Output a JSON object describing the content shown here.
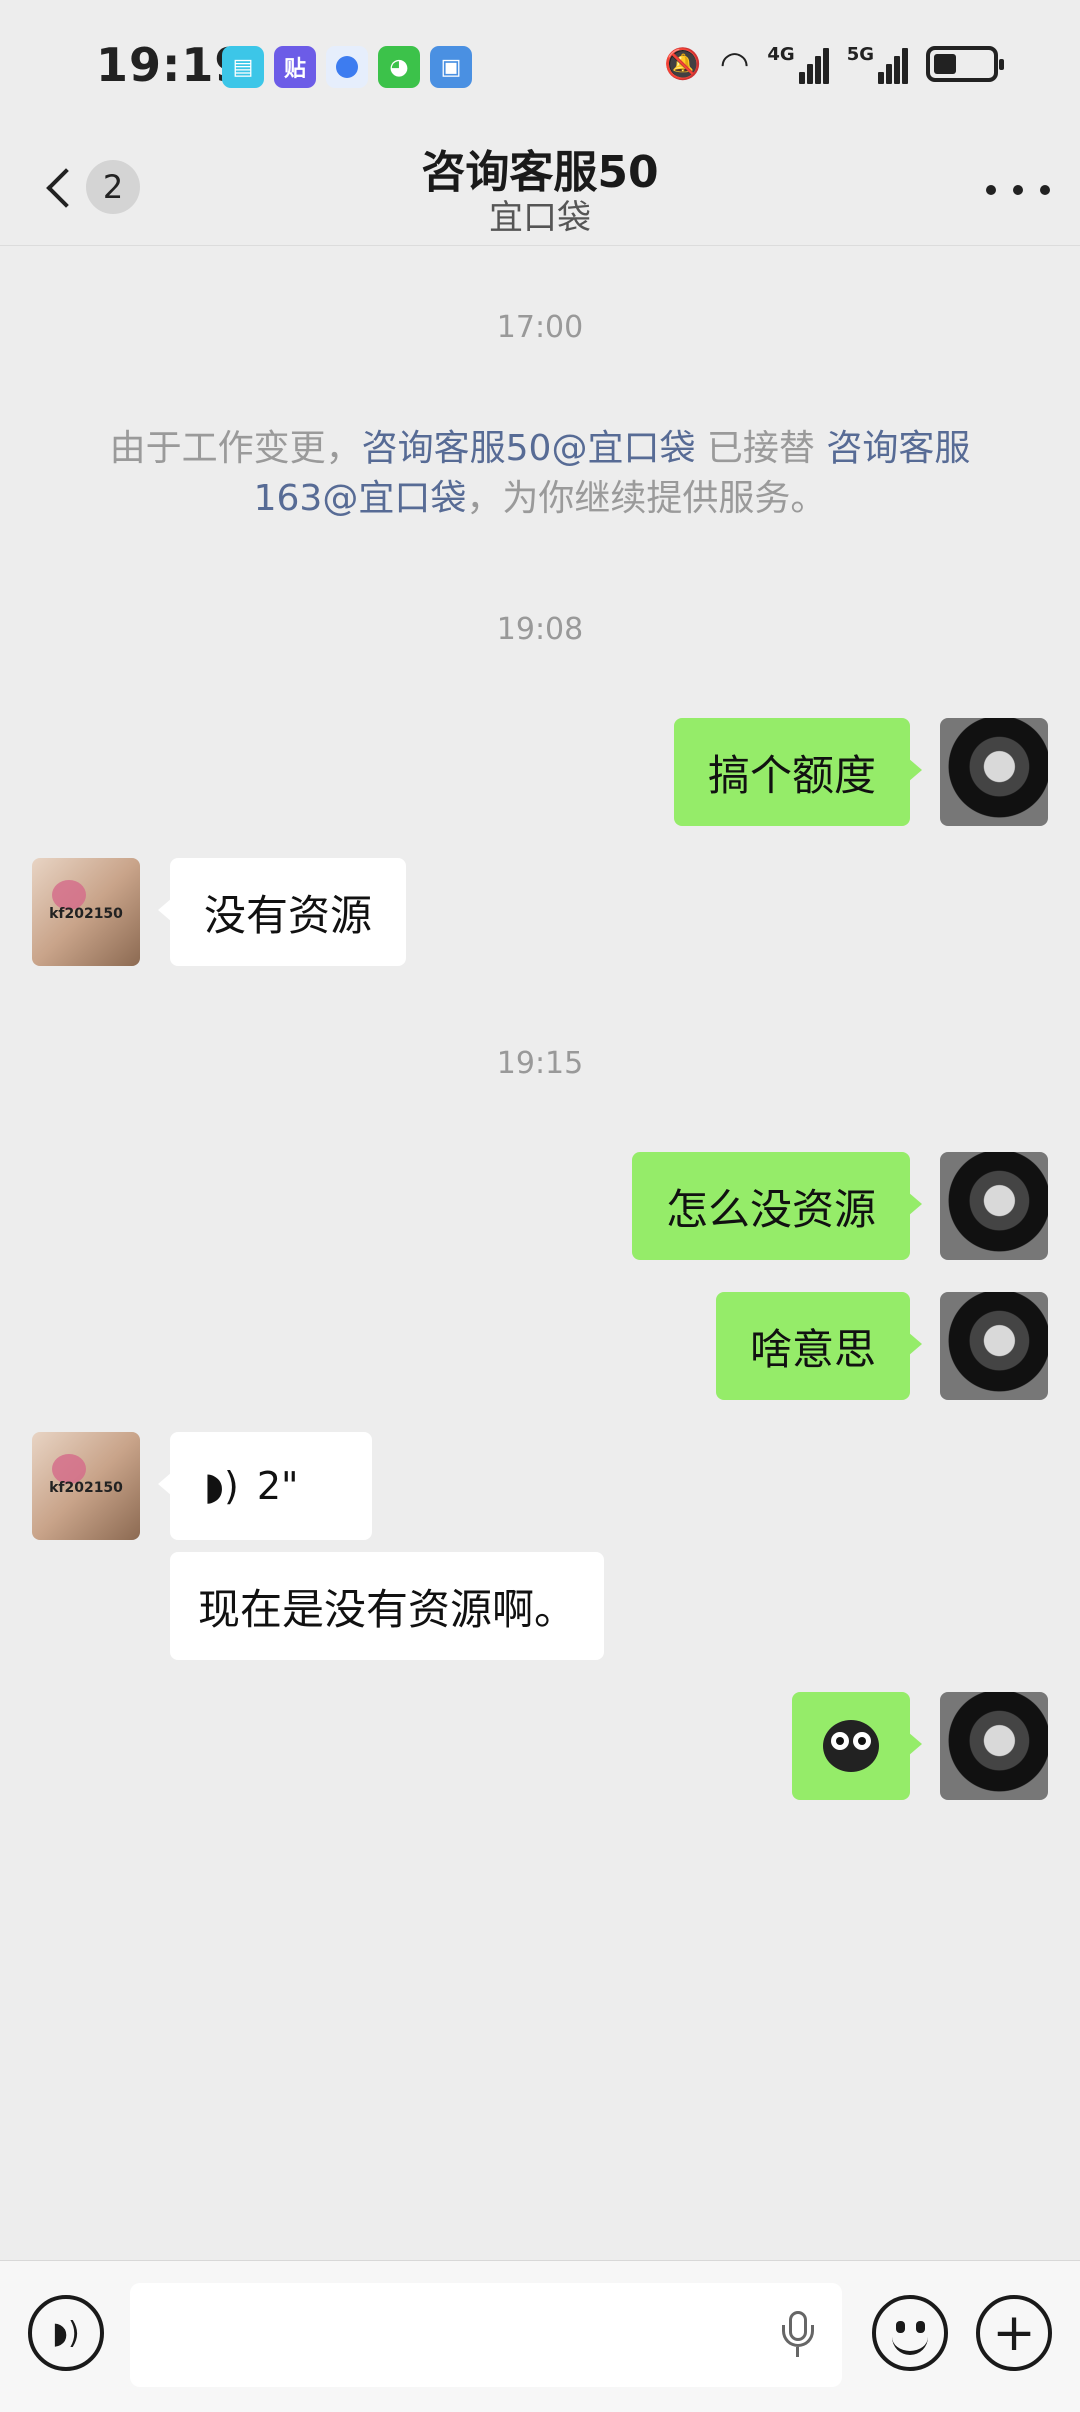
{
  "status_bar": {
    "time": "19:19",
    "network_4g": "4G",
    "network_5g": "5G",
    "app_icons": [
      "book-app-icon",
      "tieba-app-icon",
      "blue-dot-app-icon",
      "wechat-app-icon",
      "wallet-app-icon"
    ],
    "app_icon_colors": [
      "#3cc6e8",
      "#6c5ce7",
      "#3d7cf0",
      "#3cc24a",
      "#4a90e2"
    ],
    "badge_tie": "贴"
  },
  "header": {
    "back_badge": "2",
    "title": "咨询客服50",
    "subtitle": "宜口袋"
  },
  "chat": {
    "time_1": "17:00",
    "system_message": {
      "prefix": "由于工作变更，",
      "link1": "咨询客服50@宜口袋",
      "middle": " 已接替 ",
      "link2": "咨询客服163@宜口袋",
      "suffix": "，为你继续提供服务。"
    },
    "time_2": "19:08",
    "time_3": "19:15",
    "messages": [
      {
        "sender": "me",
        "text": "搞个额度"
      },
      {
        "sender": "cs",
        "text": "没有资源"
      },
      {
        "sender": "me",
        "text": "怎么没资源"
      },
      {
        "sender": "me",
        "text": "啥意思"
      },
      {
        "sender": "cs",
        "type": "voice",
        "duration": "2\""
      },
      {
        "sender": "cs",
        "text": "现在是没有资源啊。"
      },
      {
        "sender": "me",
        "type": "sticker"
      }
    ],
    "cs_avatar_text": "kf202150"
  },
  "input_bar": {
    "voice_icon": "voice-toggle-icon",
    "emoji_icon": "emoji-icon",
    "plus_icon": "plus-icon",
    "mic_icon": "mic-icon"
  }
}
